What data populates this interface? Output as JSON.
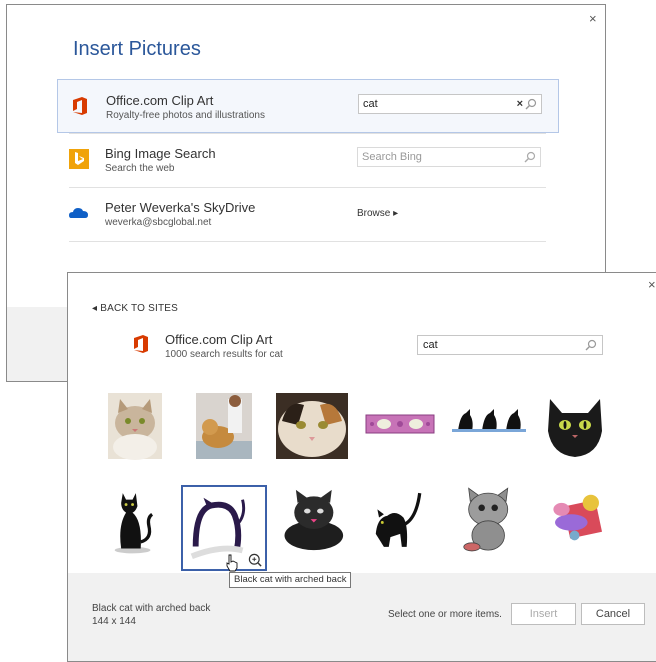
{
  "back_dialog": {
    "title": "Insert Pictures",
    "close_symbol": "×",
    "sources": [
      {
        "name": "Office.com Clip Art",
        "sub": "Royalty-free photos and illustrations",
        "icon": "office-logo-icon",
        "search_value": "cat",
        "clear_symbol": "×",
        "selected": true
      },
      {
        "name": "Bing Image Search",
        "sub": "Search the web",
        "icon": "bing-logo-icon",
        "search_placeholder": "Search Bing"
      },
      {
        "name": "Peter Weverka's SkyDrive",
        "sub": "weverka@sbcglobal.net",
        "icon": "skydrive-cloud-icon",
        "action": "Browse ▸"
      }
    ]
  },
  "front_dialog": {
    "back_link": "◂ BACK TO SITES",
    "close_symbol": "×",
    "source_name": "Office.com Clip Art",
    "result_count": "1000 search results for cat",
    "search_value": "cat",
    "results": [
      {
        "name": "cat-photo-tabby-kitten"
      },
      {
        "name": "cat-photo-vet-exam"
      },
      {
        "name": "cat-photo-calico-closeup"
      },
      {
        "name": "cat-paw-print-border"
      },
      {
        "name": "cat-silhouettes-row"
      },
      {
        "name": "black-cat-face"
      },
      {
        "name": "black-cat-sitting"
      },
      {
        "name": "black-cat-arched-back",
        "selected": true
      },
      {
        "name": "cartoon-black-cat-lying"
      },
      {
        "name": "black-cat-hissing"
      },
      {
        "name": "cartoon-gray-cat-bowl"
      },
      {
        "name": "cat-with-yarn-mouse"
      }
    ],
    "tooltip": "Black cat with arched back",
    "footer": {
      "selected_name": "Black cat with arched back",
      "selected_size": "144 x 144",
      "hint": "Select one or more items.",
      "insert_label": "Insert",
      "cancel_label": "Cancel"
    }
  },
  "colors": {
    "accent": "#2b579a",
    "office_orange": "#d83b01",
    "bing_gold": "#f0a30a",
    "skydrive_blue": "#0f5fc6"
  }
}
